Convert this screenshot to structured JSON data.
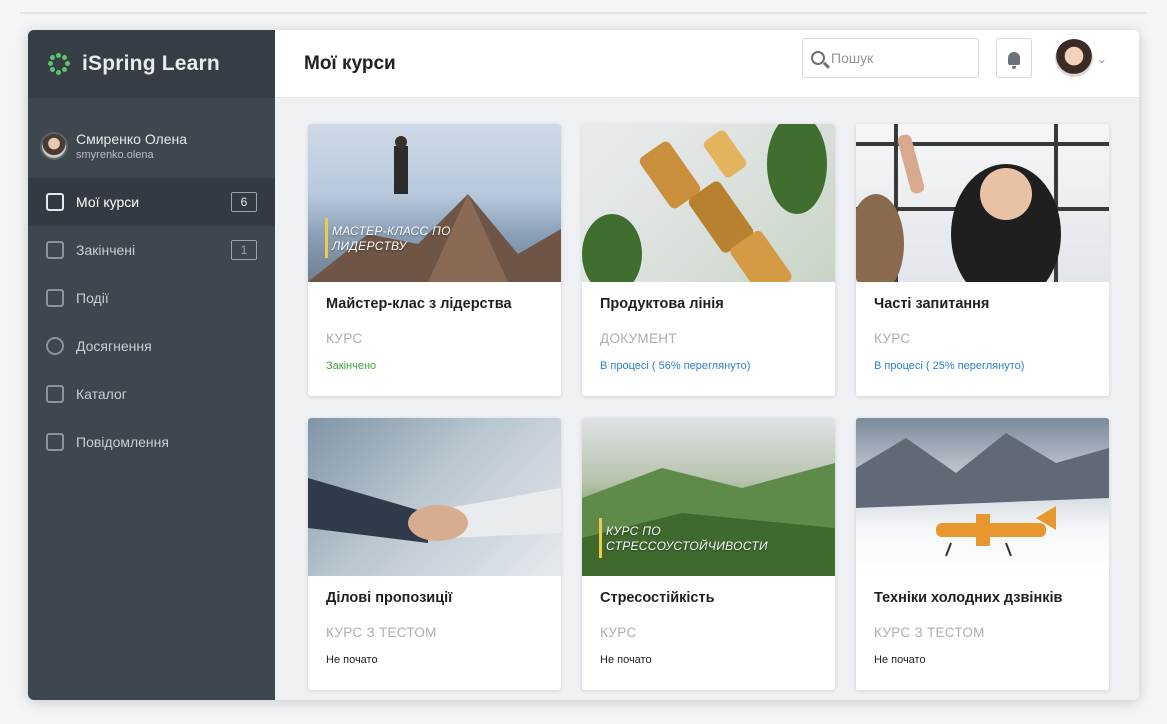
{
  "app": {
    "name": "iSpring Learn"
  },
  "user": {
    "name": "Смиренко Олена",
    "login": "smyrenko.olena"
  },
  "sidebar": {
    "items": [
      {
        "label": "Мої курси",
        "badge": "6",
        "active": true,
        "icon": "courses-icon"
      },
      {
        "label": "Закінчені",
        "badge": "1",
        "active": false,
        "icon": "completed-icon"
      },
      {
        "label": "Події",
        "badge": "",
        "active": false,
        "icon": "calendar-icon"
      },
      {
        "label": "Досягнення",
        "badge": "",
        "active": false,
        "icon": "trophy-icon"
      },
      {
        "label": "Каталог",
        "badge": "",
        "active": false,
        "icon": "catalog-icon"
      },
      {
        "label": "Повідомлення",
        "badge": "",
        "active": false,
        "icon": "messages-icon"
      }
    ]
  },
  "header": {
    "title": "Мої курси",
    "search_placeholder": "Пошук"
  },
  "cards": [
    {
      "title": "Майстер-клас з лідерства",
      "type": "КУРС",
      "status": "Закінчено",
      "status_kind": "done",
      "overlay": "МАСТЕР-КЛАСС ПО ЛИДЕРСТВУ"
    },
    {
      "title": "Продуктова лінія",
      "type": "ДОКУМЕНТ",
      "status": "В процесі ( 56% переглянуто)",
      "status_kind": "progress",
      "overlay": ""
    },
    {
      "title": "Часті запитання",
      "type": "КУРС",
      "status": "В процесі ( 25% переглянуто)",
      "status_kind": "progress",
      "overlay": ""
    },
    {
      "title": "Ділові пропозиції",
      "type": "КУРС З ТЕСТОМ",
      "status": "Не почато",
      "status_kind": "none",
      "overlay": ""
    },
    {
      "title": "Стресостійкість",
      "type": "КУРС",
      "status": "Не почато",
      "status_kind": "none",
      "overlay": "КУРС ПО СТРЕССОУСТОЙЧИВОСТИ"
    },
    {
      "title": "Техніки холодних дзвінків",
      "type": "КУРС З ТЕСТОМ",
      "status": "Не почато",
      "status_kind": "none",
      "overlay": ""
    }
  ],
  "colors": {
    "sidebar": "#3e464e",
    "done": "#3fa33a",
    "progress": "#2b7fd6",
    "brand": "#5cc46b"
  }
}
